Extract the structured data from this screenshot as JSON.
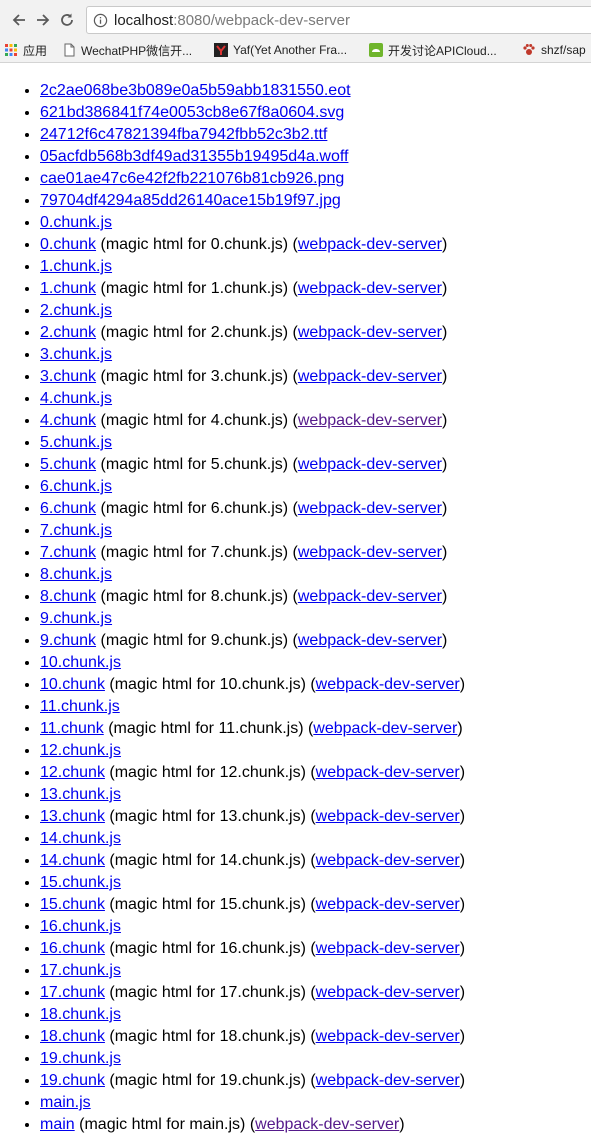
{
  "browser": {
    "url_host": "localhost",
    "url_rest": ":8080/webpack-dev-server",
    "icons": [
      "back-arrow-icon",
      "forward-arrow-icon",
      "reload-icon",
      "info-icon"
    ],
    "bookmarks": [
      {
        "label": "应用",
        "icon": "apps-grid-icon"
      },
      {
        "label": "WechatPHP微信开...",
        "icon": "page-icon"
      },
      {
        "label": "Yaf(Yet Another Fra...",
        "icon": "yaf-logo-icon"
      },
      {
        "label": "开发讨论APICloud...",
        "icon": "apicloud-logo-icon"
      },
      {
        "label": "shzf/sap",
        "icon": "paw-icon"
      }
    ]
  },
  "files": [
    {
      "link": "2c2ae068be3b089e0a5b59abb1831550.eot"
    },
    {
      "link": "621bd386841f74e0053cb8e67f8a0604.svg"
    },
    {
      "link": "24712f6c47821394fba7942fbb52c3b2.ttf"
    },
    {
      "link": "05acfdb568b3df49ad31355b19495d4a.woff"
    },
    {
      "link": "cae01ae47c6e42f2fb221076b81cb926.png"
    },
    {
      "link": "79704df4294a85dd26140ace15b19f97.jpg"
    },
    {
      "link": "0.chunk.js"
    },
    {
      "link": "0.chunk",
      "text": " (magic html for 0.chunk.js) (",
      "server": "webpack-dev-server",
      "after": ")"
    },
    {
      "link": "1.chunk.js"
    },
    {
      "link": "1.chunk",
      "text": " (magic html for 1.chunk.js) (",
      "server": "webpack-dev-server",
      "after": ")"
    },
    {
      "link": "2.chunk.js"
    },
    {
      "link": "2.chunk",
      "text": " (magic html for 2.chunk.js) (",
      "server": "webpack-dev-server",
      "after": ")"
    },
    {
      "link": "3.chunk.js"
    },
    {
      "link": "3.chunk",
      "text": " (magic html for 3.chunk.js) (",
      "server": "webpack-dev-server",
      "after": ")"
    },
    {
      "link": "4.chunk.js"
    },
    {
      "link": "4.chunk",
      "text": " (magic html for 4.chunk.js) (",
      "server": "webpack-dev-server",
      "after": ")",
      "server_visited": true
    },
    {
      "link": "5.chunk.js"
    },
    {
      "link": "5.chunk",
      "text": " (magic html for 5.chunk.js) (",
      "server": "webpack-dev-server",
      "after": ")"
    },
    {
      "link": "6.chunk.js"
    },
    {
      "link": "6.chunk",
      "text": " (magic html for 6.chunk.js) (",
      "server": "webpack-dev-server",
      "after": ")"
    },
    {
      "link": "7.chunk.js"
    },
    {
      "link": "7.chunk",
      "text": " (magic html for 7.chunk.js) (",
      "server": "webpack-dev-server",
      "after": ")"
    },
    {
      "link": "8.chunk.js"
    },
    {
      "link": "8.chunk",
      "text": " (magic html for 8.chunk.js) (",
      "server": "webpack-dev-server",
      "after": ")"
    },
    {
      "link": "9.chunk.js"
    },
    {
      "link": "9.chunk",
      "text": " (magic html for 9.chunk.js) (",
      "server": "webpack-dev-server",
      "after": ")"
    },
    {
      "link": "10.chunk.js"
    },
    {
      "link": "10.chunk",
      "text": " (magic html for 10.chunk.js) (",
      "server": "webpack-dev-server",
      "after": ")"
    },
    {
      "link": "11.chunk.js"
    },
    {
      "link": "11.chunk",
      "text": " (magic html for 11.chunk.js) (",
      "server": "webpack-dev-server",
      "after": ")"
    },
    {
      "link": "12.chunk.js"
    },
    {
      "link": "12.chunk",
      "text": " (magic html for 12.chunk.js) (",
      "server": "webpack-dev-server",
      "after": ")"
    },
    {
      "link": "13.chunk.js"
    },
    {
      "link": "13.chunk",
      "text": " (magic html for 13.chunk.js) (",
      "server": "webpack-dev-server",
      "after": ")"
    },
    {
      "link": "14.chunk.js"
    },
    {
      "link": "14.chunk",
      "text": " (magic html for 14.chunk.js) (",
      "server": "webpack-dev-server",
      "after": ")"
    },
    {
      "link": "15.chunk.js"
    },
    {
      "link": "15.chunk",
      "text": " (magic html for 15.chunk.js) (",
      "server": "webpack-dev-server",
      "after": ")"
    },
    {
      "link": "16.chunk.js"
    },
    {
      "link": "16.chunk",
      "text": " (magic html for 16.chunk.js) (",
      "server": "webpack-dev-server",
      "after": ")"
    },
    {
      "link": "17.chunk.js"
    },
    {
      "link": "17.chunk",
      "text": " (magic html for 17.chunk.js) (",
      "server": "webpack-dev-server",
      "after": ")"
    },
    {
      "link": "18.chunk.js"
    },
    {
      "link": "18.chunk",
      "text": " (magic html for 18.chunk.js) (",
      "server": "webpack-dev-server",
      "after": ")"
    },
    {
      "link": "19.chunk.js"
    },
    {
      "link": "19.chunk",
      "text": " (magic html for 19.chunk.js) (",
      "server": "webpack-dev-server",
      "after": ")"
    },
    {
      "link": "main.js"
    },
    {
      "link": "main",
      "text": " (magic html for main.js) (",
      "server": "webpack-dev-server",
      "after": ")",
      "server_visited": true
    }
  ],
  "colors": {
    "link": "#0000ee",
    "visited_link": "#551a8b",
    "chrome_bg": "#f2f2f2"
  }
}
